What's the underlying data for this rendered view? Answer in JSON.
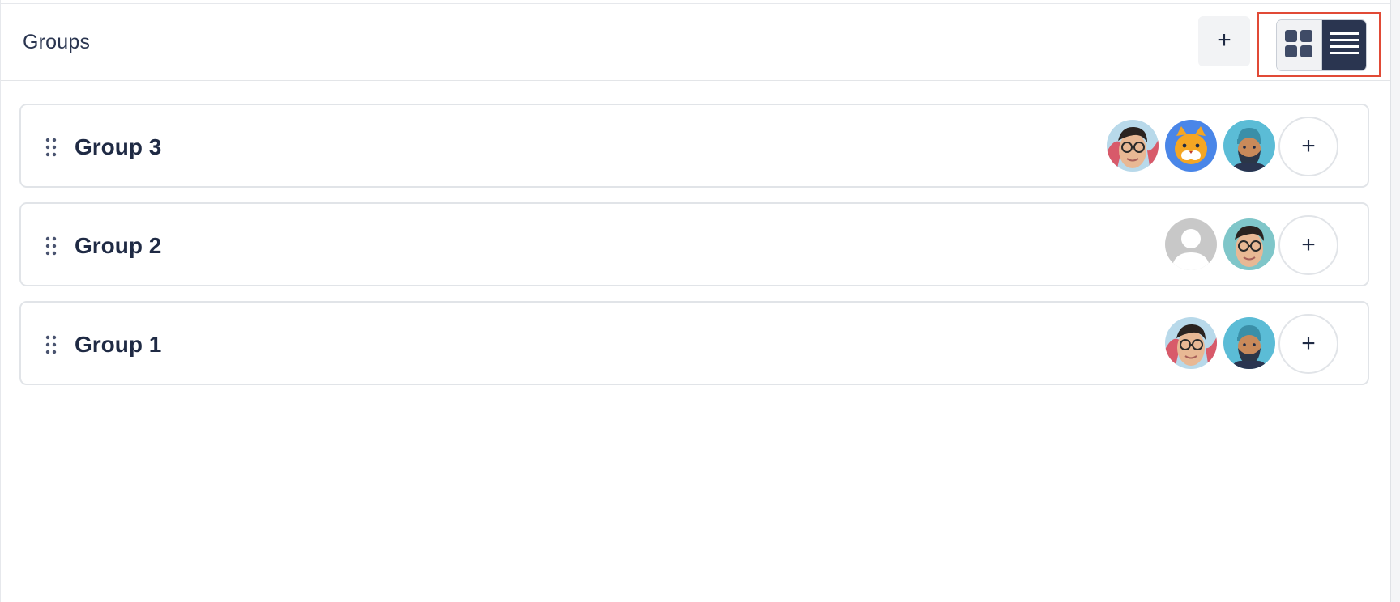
{
  "header": {
    "title": "Groups",
    "add_button_label": "+",
    "view_toggle": {
      "options": [
        "grid",
        "list"
      ],
      "selected": "list",
      "highlighted": true,
      "highlight_color": "#e14a36"
    }
  },
  "groups": [
    {
      "name": "Group 3",
      "members": [
        "person-glasses-avatar",
        "cat-avatar",
        "bearded-man-avatar"
      ],
      "add_member_label": "+"
    },
    {
      "name": "Group 2",
      "members": [
        "default-user-avatar",
        "person-glasses-avatar"
      ],
      "add_member_label": "+"
    },
    {
      "name": "Group 1",
      "members": [
        "person-glasses-avatar",
        "bearded-man-avatar"
      ],
      "add_member_label": "+"
    }
  ],
  "colors": {
    "primary_dark": "#2a3550",
    "border": "#e1e4e8",
    "highlight": "#e14a36",
    "avatar_blue": "#4a86e8",
    "avatar_teal": "#5bbcd6"
  }
}
